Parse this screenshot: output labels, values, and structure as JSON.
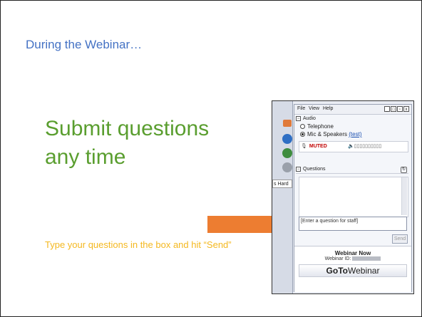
{
  "slide": {
    "section_title": "During the Webinar…",
    "headline": "Submit questions any time",
    "caption": "Type your questions in the box and hit “Send”"
  },
  "colors": {
    "section_title": "#4472c4",
    "headline": "#5a9e2f",
    "caption": "#f4b820",
    "arrow": "#ed7d31"
  },
  "panel": {
    "menu": [
      "File",
      "View",
      "Help"
    ],
    "window_buttons": [
      "_",
      "□",
      "▫",
      "x"
    ],
    "audio_heading": "Audio",
    "telephone_label": "Telephone",
    "mic_label": "Mic & Speakers",
    "test_link": "(test)",
    "muted_label": "MUTED",
    "questions_heading": "Questions",
    "question_placeholder": "[Enter a question for staff]",
    "send_label": "Send",
    "partial_tab_label": "s Hard",
    "webinar_now": "Webinar Now",
    "webinar_id_label": "Webinar ID:",
    "logo_bold": "GoTo",
    "logo_regular": "Webinar",
    "selected_audio": "Mic & Speakers"
  }
}
